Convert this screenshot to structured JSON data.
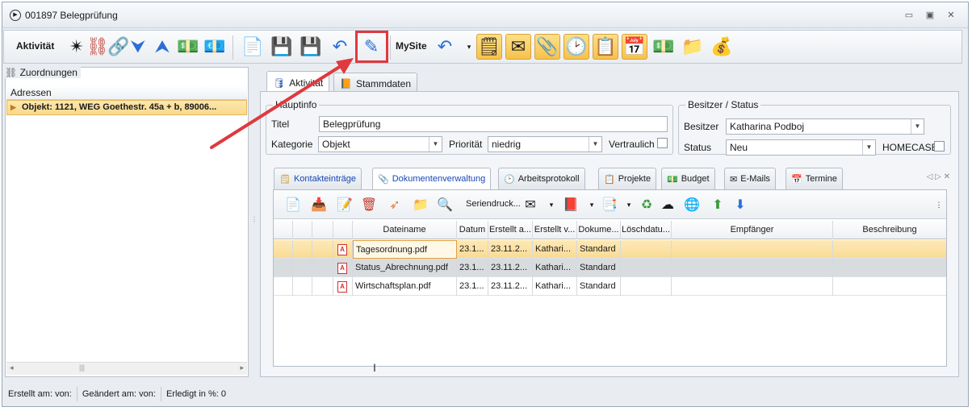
{
  "window": {
    "title": "001897 Belegprüfung",
    "controls": [
      "▭",
      "▣",
      "✕"
    ]
  },
  "toolbar": {
    "label_activity": "Aktivität",
    "label_mysite": "MySite",
    "icons_group1": [
      "new-activity-icon",
      "link-icon",
      "unlink-icon",
      "chevron-down-icon",
      "chevron-up-icon",
      "money-add-icon",
      "money-remove-icon"
    ],
    "icons_group2": [
      "new-document-icon",
      "save-icon",
      "save-close-icon",
      "undo-delete-icon",
      "edit-pen-icon"
    ],
    "icons_group3": [
      "notes-icon",
      "mail-icon",
      "paperclip-icon",
      "clock-icon",
      "clipboard-icon",
      "calendar-icon",
      "money-icon",
      "folder-add-icon",
      "coins-icon"
    ]
  },
  "left": {
    "group_title": "Zuordnungen",
    "column_header": "Adressen",
    "rows": [
      "Objekt: 1121, WEG Goethestr. 45a + b, 89006..."
    ]
  },
  "tabs": {
    "activity": "Aktivität",
    "masterdata": "Stammdaten"
  },
  "hauptinfo": {
    "legend": "Hauptinfo",
    "title_label": "Titel",
    "title_value": "Belegprüfung",
    "category_label": "Kategorie",
    "category_value": "Objekt",
    "priority_label": "Priorität",
    "priority_value": "niedrig",
    "confidential_label": "Vertraulich"
  },
  "owner_status": {
    "legend": "Besitzer / Status",
    "owner_label": "Besitzer",
    "owner_value": "Katharina Podboj",
    "status_label": "Status",
    "status_value": "Neu",
    "homecase_label": "HOMECASE"
  },
  "subtabs": [
    "Kontakteinträge",
    "Dokumentenverwaltung",
    "Arbeitsprotokoll",
    "Projekte",
    "Budget",
    "E-Mails",
    "Termine"
  ],
  "doc_toolbar": {
    "serial_print": "Seriendruck..."
  },
  "grid": {
    "headers": [
      "Dateiname",
      "Datum",
      "Erstellt a...",
      "Erstellt v...",
      "Dokume...",
      "Löschdatu...",
      "Empfänger",
      "Beschreibung"
    ],
    "rows": [
      {
        "file": "Tagesordnung.pdf",
        "date": "23.1...",
        "created_at": "23.11.2...",
        "created_by": "Kathari...",
        "doctype": "Standard"
      },
      {
        "file": "Status_Abrechnung.pdf",
        "date": "23.1...",
        "created_at": "23.11.2...",
        "created_by": "Kathari...",
        "doctype": "Standard"
      },
      {
        "file": "Wirtschaftsplan.pdf",
        "date": "23.1...",
        "created_at": "23.11.2...",
        "created_by": "Kathari...",
        "doctype": "Standard"
      }
    ]
  },
  "statusbar": {
    "created": "Erstellt am:  von:",
    "changed": "Geändert am:  von:",
    "done": "Erledigt in %:  0"
  },
  "colors": {
    "accent_highlight": "#f9d98c",
    "annotation_red": "#e0393e"
  }
}
